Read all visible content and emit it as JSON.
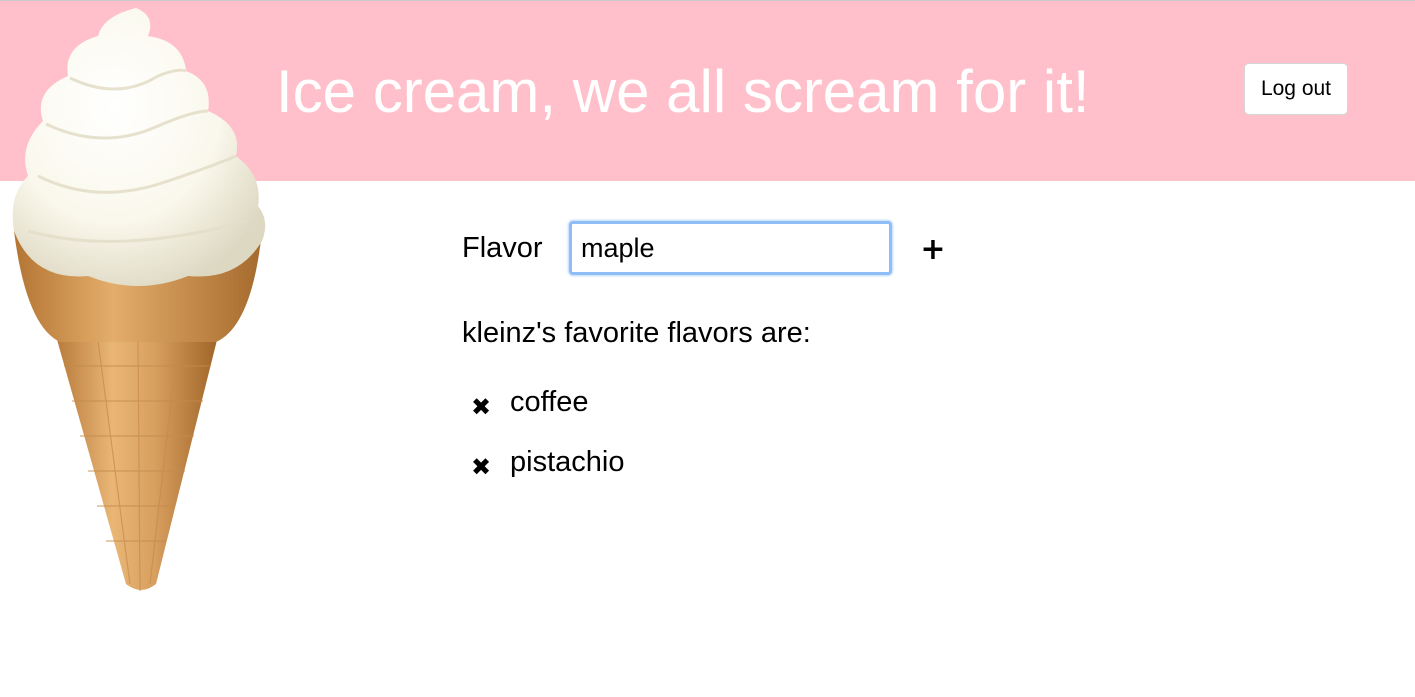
{
  "header": {
    "title": "Ice cream, we all scream for it!",
    "logout_label": "Log out",
    "background_color": "#ffc0cb"
  },
  "logo": {
    "icon": "ice-cream-cone-icon"
  },
  "form": {
    "flavor_label": "Flavor",
    "flavor_value": "maple",
    "add_label": "+"
  },
  "favorites": {
    "heading": "kleinz's favorite flavors are:",
    "remove_icon": "✖",
    "items": [
      {
        "name": "coffee"
      },
      {
        "name": "pistachio"
      }
    ]
  }
}
